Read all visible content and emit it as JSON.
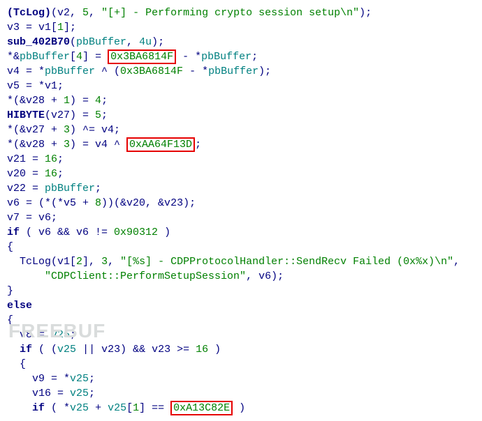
{
  "code": {
    "l1": {
      "a": "(TcLog)",
      "b": "(v2, ",
      "c": "5",
      "d": ", ",
      "e": "\"[+] - Performing crypto session setup\\n\"",
      "f": ");"
    },
    "l2": {
      "a": "v3 = v1[",
      "b": "1",
      "c": "];"
    },
    "l3": {
      "a": "sub_402B70",
      "b": "(",
      "c": "pbBuffer",
      "d": ", ",
      "e": "4u",
      "f": ");"
    },
    "l4": {
      "a": "*&",
      "b": "pbBuffer",
      "c": "[",
      "d": "4",
      "e": "] = ",
      "f": "0x3BA6814F",
      "g": " - *",
      "h": "pbBuffer",
      "i": ";"
    },
    "l5": {
      "a": "v4 = *",
      "b": "pbBuffer",
      "c": " ^ (",
      "d": "0x3BA6814F",
      "e": " - *",
      "f": "pbBuffer",
      "g": ");"
    },
    "l6": {
      "a": "v5 = *v1;"
    },
    "l7": {
      "a": "*(&v28 + ",
      "b": "1",
      "c": ") = ",
      "d": "4",
      "e": ";"
    },
    "l8": {
      "a": "HIBYTE",
      "b": "(v27) = ",
      "c": "5",
      "d": ";"
    },
    "l9": {
      "a": "*(&v27 + ",
      "b": "3",
      "c": ") ^= v4;"
    },
    "l10": {
      "a": "*(&v28 + ",
      "b": "3",
      "c": ") = v4 ^ ",
      "d": "0xAA64F13D",
      "e": ";"
    },
    "l11": {
      "a": "v21 = ",
      "b": "16",
      "c": ";"
    },
    "l12": {
      "a": "v20 = ",
      "b": "16",
      "c": ";"
    },
    "l13": {
      "a": "v22 = ",
      "b": "pbBuffer",
      "c": ";"
    },
    "l14": {
      "a": "v6 = (*(*v5 + ",
      "b": "8",
      "c": "))(&v20, &v23);"
    },
    "l15": {
      "a": "v7 = v6;"
    },
    "l16": {
      "a": "if",
      "b": " ( v6 && v6 != ",
      "c": "0x90312",
      "d": " )"
    },
    "l17": {
      "a": "{"
    },
    "l18": {
      "a": "  TcLog(v1[",
      "b": "2",
      "c": "], ",
      "d": "3",
      "e": ", ",
      "f": "\"[%s] - CDPProtocolHandler::SendRecv Failed (0x%x)\\n\"",
      "g": ","
    },
    "l19": {
      "a": "      ",
      "b": "\"CDPClient::PerformSetupSession\"",
      "c": ", v6);"
    },
    "l20": {
      "a": "}"
    },
    "l21": {
      "a": "else"
    },
    "l22": {
      "a": "{"
    },
    "l23": {
      "a": "  v8 = ",
      "b": "v25",
      "c": ";"
    },
    "l24": {
      "a": "  ",
      "b": "if",
      "c": " ( (",
      "d": "v25",
      "e": " || v23) && v23 >= ",
      "f": "16",
      "g": " )"
    },
    "l25": {
      "a": "  {"
    },
    "l26": {
      "a": "    v9 = *",
      "b": "v25",
      "c": ";"
    },
    "l27": {
      "a": "    v16 = ",
      "b": "v25",
      "c": ";"
    },
    "l28": {
      "a": "    ",
      "b": "if",
      "c": " ( *",
      "d": "v25",
      "e": " + ",
      "f": "v25",
      "g": "[",
      "h": "1",
      "i": "] == ",
      "j": "0xA13C82E",
      "k": " )"
    }
  },
  "watermark": "FREEBUF"
}
